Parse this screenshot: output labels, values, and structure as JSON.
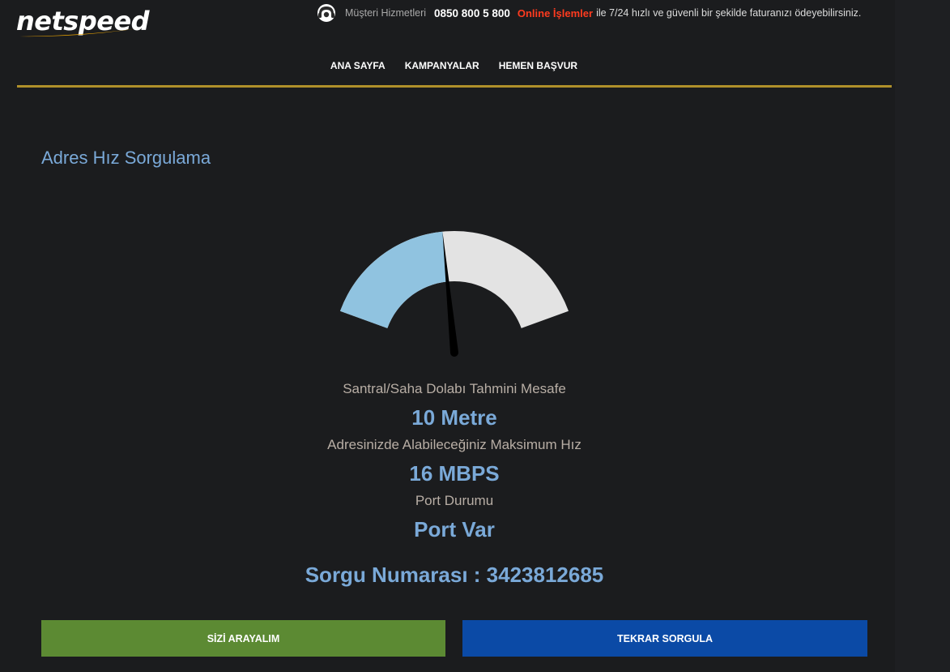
{
  "header": {
    "logo": "netspeed",
    "support_label": "Müşteri Hizmetleri",
    "phone": "0850 800 5 800",
    "online_label": "Online İşlemler",
    "online_text": "ile 7/24 hızlı ve güvenli bir şekilde faturanızı ödeyebilirsiniz.",
    "support_icon": "headset-icon"
  },
  "nav": {
    "items": [
      "ANA SAYFA",
      "KAMPANYALAR",
      "HEMEN BAŞVUR"
    ]
  },
  "page": {
    "title": "Adres Hız Sorgulama"
  },
  "gauge": {
    "value_fraction": 0.46,
    "fill_color": "#90c3e0",
    "track_color": "#e3e3e3",
    "needle_color": "#000000"
  },
  "results": {
    "distance_label": "Santral/Saha Dolabı Tahmini Mesafe",
    "distance_value": "10 Metre",
    "speed_label": "Adresinizde Alabileceğiniz Maksimum Hız",
    "speed_value": "16 MBPS",
    "port_label": "Port Durumu",
    "port_value": "Port Var",
    "query_number": "Sorgu Numarası : 3423812685"
  },
  "buttons": {
    "call_me": "SİZİ ARAYALIM",
    "query_again": "TEKRAR SORGULA"
  },
  "colors": {
    "background": "#1b1c1e",
    "accent_blue": "#7aa9d8",
    "gold": "#b0902a",
    "green_button": "#5c8a33",
    "blue_button": "#0b4aa6",
    "online_red": "#ff3b1f"
  }
}
